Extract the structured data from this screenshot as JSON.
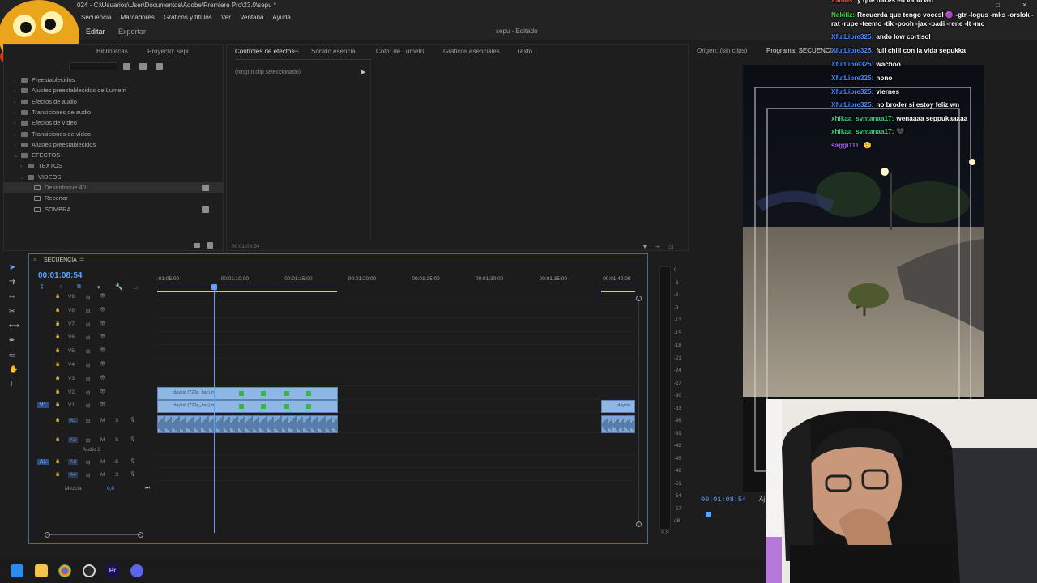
{
  "window": {
    "title": "024 - C:\\Usuarios\\User\\Documentos\\Adobe\\Premiere Pro\\23.0\\sepu *"
  },
  "menu": [
    "Secuencia",
    "Marcadores",
    "Gráficos y títulos",
    "Ver",
    "Ventana",
    "Ayuda"
  ],
  "workspace": {
    "tabs": [
      "Editar",
      "Exportar"
    ],
    "active": "Editar",
    "project_status": "sepu - Editado"
  },
  "effects_panel": {
    "tabs": [
      "Bibliotecas",
      "Proyecto: sepu"
    ],
    "tree": [
      {
        "label": "Preestablecidos",
        "indent": 1,
        "kind": "folder"
      },
      {
        "label": "Ajustes preestablecidos de Lumetri",
        "indent": 1,
        "kind": "folder"
      },
      {
        "label": "Efectos de audio",
        "indent": 1,
        "kind": "folder"
      },
      {
        "label": "Transiciones de audio",
        "indent": 1,
        "kind": "folder"
      },
      {
        "label": "Efectos de vídeo",
        "indent": 1,
        "kind": "folder"
      },
      {
        "label": "Transiciones de vídeo",
        "indent": 1,
        "kind": "folder"
      },
      {
        "label": "Ajustes preestablecidos",
        "indent": 1,
        "kind": "folder"
      },
      {
        "label": "EFECTOS",
        "indent": 1,
        "kind": "folder-open"
      },
      {
        "label": "TEXTOS",
        "indent": 2,
        "kind": "folder"
      },
      {
        "label": "VIDEOS",
        "indent": 2,
        "kind": "folder-open"
      },
      {
        "label": "Desenfoque 40",
        "indent": 3,
        "kind": "preset",
        "selected": true
      },
      {
        "label": "Recortar",
        "indent": 3,
        "kind": "preset"
      },
      {
        "label": "SOMBRA",
        "indent": 3,
        "kind": "preset"
      }
    ]
  },
  "effect_controls": {
    "tabs": [
      "Controles de efectos",
      "Sonido esencial",
      "Color de Lumetri",
      "Gráficos esenciales",
      "Texto"
    ],
    "active": "Controles de efectos",
    "no_clip": "(ningún clip seleccionado)",
    "timecode": "00:01:08:54"
  },
  "monitors": {
    "source": "Origen: (sin clips)",
    "program": "Programa: SECUENCIA",
    "program_timecode": "00:01:08:54"
  },
  "timeline": {
    "name": "SECUENCIA",
    "timecode": "00:01:08:54",
    "ruler": [
      ":01:05:00",
      "00:01:10:00",
      "00:01:15:00",
      "00:01:20:00",
      "00:01:25:00",
      "00:01:30:00",
      "00:01:35:00",
      "00:01:40:00"
    ],
    "video_tracks": [
      "V9",
      "V8",
      "V7",
      "V6",
      "V5",
      "V4",
      "V3",
      "V2",
      "V1"
    ],
    "audio_tracks": [
      "A1",
      "A2",
      "A3",
      "A4"
    ],
    "audio2_name": "Audio 2",
    "mix_label": "Mezcla",
    "mix_value": "0,0",
    "source_v1": "V1",
    "source_a1": "A1",
    "clip_label": "playlist (720p_bac).m",
    "clip_label_short": "playlist",
    "m_label": "M",
    "s_label": "S"
  },
  "meter_scale": [
    "0",
    "-3",
    "-6",
    "-9",
    "-12",
    "-15",
    "-18",
    "-21",
    "-24",
    "-27",
    "-30",
    "-33",
    "-36",
    "-39",
    "-42",
    "-45",
    "-48",
    "-51",
    "-54",
    "-57",
    "dB"
  ],
  "meter_ss": "S S",
  "chat": [
    {
      "user": "Zalnos:",
      "text": "y que haces en vapo wn",
      "color": "#ff4d4d"
    },
    {
      "user": "Nakifiz:",
      "text": "Recuerda que tengo vocesl 🟣 -gtr -logus -mks -orslok -rat -rupe -teemo -tik -pooh -jax -badi -rene -lt -mc",
      "color": "#3fd13f"
    },
    {
      "user": "XfutLibre325:",
      "text": "ando low cortisol",
      "color": "#4a8cff"
    },
    {
      "user": "XfutLibre325:",
      "text": "full chill con la vida sepukka",
      "color": "#4a8cff"
    },
    {
      "user": "XfutLibre325:",
      "text": "wachoo",
      "color": "#4a8cff"
    },
    {
      "user": "XfutLibre325:",
      "text": "nono",
      "color": "#4a8cff"
    },
    {
      "user": "XfutLibre325:",
      "text": "viernes",
      "color": "#4a8cff"
    },
    {
      "user": "XfutLibre325:",
      "text": "no broder si estoy feliz wn",
      "color": "#4a8cff"
    },
    {
      "user": "xhikaa_svntanaa17:",
      "text": "wenaaaa seppukaaaaa",
      "color": "#3fd17a"
    },
    {
      "user": "xhikaa_svntanaa17:",
      "text": "🖤",
      "color": "#3fd17a"
    },
    {
      "user": "saggi111:",
      "text": "🙂",
      "color": "#b565ff"
    }
  ],
  "colors": {
    "accent": "#2d8ceb",
    "timeline_border": "#3b6bb0",
    "clip": "#8fb7e4",
    "playhead": "#5aa3ff"
  },
  "taskbar_icons": [
    "windows-start-icon",
    "file-explorer-icon",
    "chrome-icon",
    "obs-icon",
    "premiere-icon",
    "discord-icon"
  ]
}
